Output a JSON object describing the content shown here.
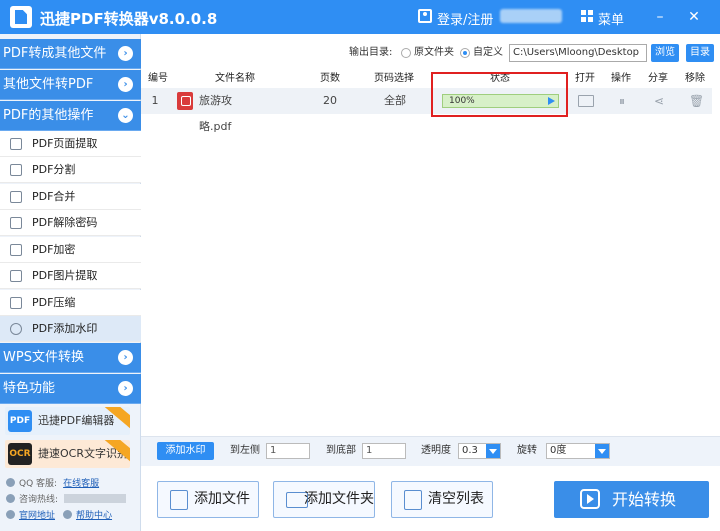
{
  "app": {
    "title": "迅捷PDF转换器v8.0.0.8",
    "login": "登录/注册",
    "menu": "菜单"
  },
  "sidebar": {
    "sections": [
      {
        "label": "PDF转成其他文件"
      },
      {
        "label": "其他文件转PDF"
      },
      {
        "label": "PDF的其他操作"
      }
    ],
    "items": [
      {
        "label": "PDF页面提取"
      },
      {
        "label": "PDF分割"
      },
      {
        "label": "PDF合并"
      },
      {
        "label": "PDF解除密码"
      },
      {
        "label": "PDF加密"
      },
      {
        "label": "PDF图片提取"
      },
      {
        "label": "PDF压缩"
      },
      {
        "label": "PDF添加水印"
      }
    ],
    "sections2": [
      {
        "label": "WPS文件转换"
      },
      {
        "label": "特色功能"
      }
    ],
    "promos": [
      {
        "label": "迅捷PDF编辑器",
        "icon": "PDF",
        "color": "#2f8ef3"
      },
      {
        "label": "捷速OCR文字识别",
        "icon": "OCR",
        "color": "#222222"
      }
    ],
    "contact": {
      "qq_label": "QQ 客服:",
      "qq_link": "在线客服",
      "phone_label": "咨询热线:",
      "site_link": "官网地址",
      "help_link": "帮助中心"
    }
  },
  "output": {
    "label": "输出目录:",
    "opt1": "原文件夹",
    "opt2": "自定义",
    "path": "C:\\Users\\Mloong\\Desktop",
    "browse": "浏览",
    "dir": "目录"
  },
  "table": {
    "headers": [
      "编号",
      "文件名称",
      "页数",
      "页码选择",
      "状态",
      "打开",
      "操作",
      "分享",
      "移除"
    ],
    "rows": [
      {
        "no": "1",
        "name": "旅游攻略.pdf",
        "pages": "20",
        "range": "全部",
        "status": "100%"
      }
    ]
  },
  "watermark": {
    "button": "添加水印",
    "left_label": "到左侧",
    "left_value": "1",
    "bottom_label": "到底部",
    "bottom_value": "1",
    "opacity_label": "透明度",
    "opacity_value": "0.3",
    "rotate_label": "旋转",
    "rotate_value": "0度"
  },
  "actions": {
    "add_file": "添加文件",
    "add_folder": "添加文件夹",
    "clear": "清空列表",
    "start": "开始转换"
  },
  "colors": {
    "accent": "#2f8ef3",
    "progress": "#d7f0c8",
    "highlight": "#e02020"
  }
}
